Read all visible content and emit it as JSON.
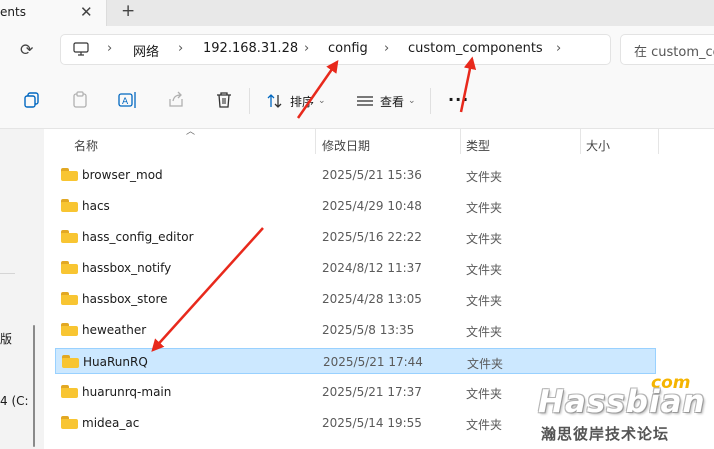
{
  "tab": {
    "title": "ents",
    "close_glyph": "✕",
    "new_glyph": "+"
  },
  "address": {
    "crumbs": [
      "网络",
      "192.168.31.28",
      "config",
      "custom_components"
    ],
    "search_placeholder": "在 custom_co"
  },
  "toolbar": {
    "sort_label": "排序",
    "view_label": "查看",
    "more_glyph": "···"
  },
  "columns": {
    "name": "名称",
    "date": "修改日期",
    "type": "类型",
    "size": "大小"
  },
  "nav": {
    "text1": "版",
    "text2": "4 (C:"
  },
  "rows": [
    {
      "name": "browser_mod",
      "date": "2025/5/21 15:36",
      "type": "文件夹"
    },
    {
      "name": "hacs",
      "date": "2025/4/29 10:48",
      "type": "文件夹"
    },
    {
      "name": "hass_config_editor",
      "date": "2025/5/16 22:22",
      "type": "文件夹"
    },
    {
      "name": "hassbox_notify",
      "date": "2024/8/12 11:37",
      "type": "文件夹"
    },
    {
      "name": "hassbox_store",
      "date": "2025/4/28 13:05",
      "type": "文件夹"
    },
    {
      "name": "heweather",
      "date": "2025/5/8 13:35",
      "type": "文件夹"
    },
    {
      "name": "HuaRunRQ",
      "date": "2025/5/21 17:44",
      "type": "文件夹",
      "selected": true
    },
    {
      "name": "huarunrq-main",
      "date": "2025/5/21 17:37",
      "type": "文件夹"
    },
    {
      "name": "midea_ac",
      "date": "2025/5/14 19:55",
      "type": "文件夹"
    }
  ],
  "watermark": {
    "domain": "com",
    "brand": "Hassbian",
    "subtitle": "瀚思彼岸技术论坛"
  },
  "colors": {
    "selection": "#cce8ff",
    "folder": "#f8c532",
    "arrow": "#e8291c",
    "accent": "#0067c0"
  }
}
